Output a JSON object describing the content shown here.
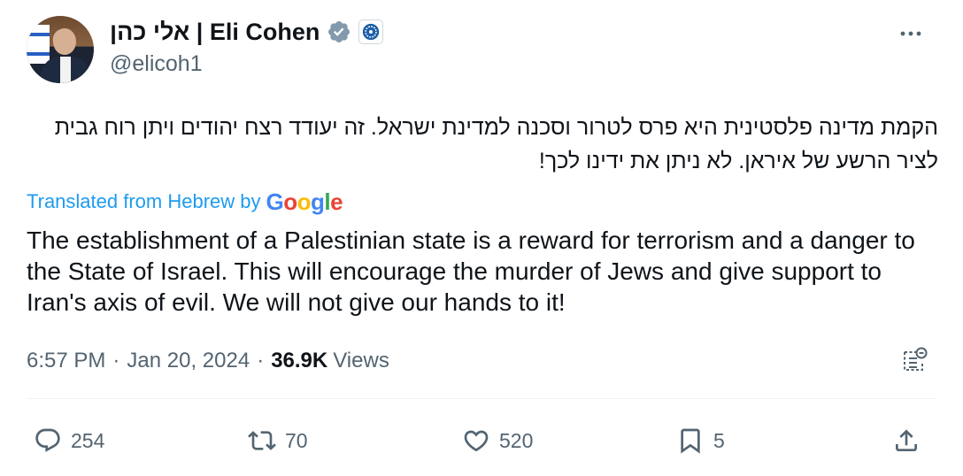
{
  "author": {
    "display_name": "אלי כהן | Eli Cohen",
    "handle": "@elicoh1",
    "verified_icon": "verified-badge-icon",
    "affiliate_icon": "government-affiliate-icon"
  },
  "tweet": {
    "hebrew_text": "הקמת מדינה פלסטינית היא פרס לטרור וסכנה למדינת ישראל. זה יעודד רצח יהודים ויתן רוח גבית לציר הרשע של איראן. לא ניתן את ידינו לכך!",
    "translated_label": "Translated from Hebrew by",
    "translation_provider": "Google",
    "english_text": "The establishment of a Palestinian state is a reward for terrorism and a danger to the State of Israel. This will encourage the murder of Jews and give support to Iran's axis of evil. We will not give our hands to it!",
    "time": "6:57 PM",
    "date": "Jan 20, 2024",
    "separator": "·",
    "views_count": "36.9K",
    "views_label": "Views"
  },
  "actions": {
    "replies": "254",
    "reposts": "70",
    "likes": "520",
    "bookmarks": "5"
  },
  "colors": {
    "text": "#0f1419",
    "secondary": "#536471",
    "link": "#1d9bf0",
    "verified_badge": "#829aab"
  }
}
